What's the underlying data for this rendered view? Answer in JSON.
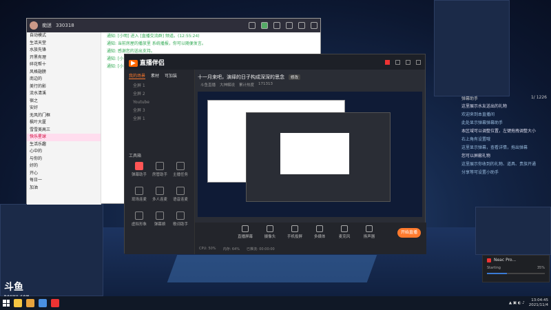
{
  "chat_window": {
    "user": "痴迷",
    "id_label": "330318",
    "left_list": [
      "自动模式",
      "生活天堂",
      "水族先锋",
      "开黑有理",
      "碎花帮十",
      "风格翅膀",
      "南边的",
      "美行的影",
      "流水清溪",
      "宿之",
      "安好",
      "无风的门框",
      "枫叶大厦",
      "雪雪美高三",
      "快乐星球",
      "生活乐趣",
      "心中的",
      "与你的",
      "好的",
      "开心",
      "每日一",
      "加油"
    ],
    "right_lines": [
      "通知: [小明] 进入 [直播交流群] 频道。(12:55:24)",
      "通知: 当前房屋的播放里 系统播报，你可以随便发言。",
      "通知: 感谢您的送出支持。",
      "通知: [小 ] 加入频道",
      "通知: [小] 进入频道"
    ]
  },
  "app": {
    "logo": "直播伴侣",
    "tabs": [
      "我的场景",
      "素材",
      "可加装"
    ],
    "scenes": [
      "全屏 1",
      "全屏 2",
      "Youtube",
      "全屏 3",
      "全屏 1"
    ],
    "tool_title": "工具箱",
    "tools": [
      "弹幕助手",
      "房管助手",
      "主播任务",
      "现场连麦",
      "多人连麦",
      "语音连麦",
      "虚拟形象",
      "弹幕娘",
      "歌词助手"
    ],
    "room_title": "十一月来吧，演绎的日子构成深深的思念",
    "room_tag": "修改",
    "room_sub": [
      "斗鱼直播",
      "大神解说",
      "累计热度",
      "171313"
    ],
    "bottom_items": [
      "直播屏幕",
      "摄像头",
      "手机投屏",
      "多媒体",
      "麦克风",
      "扬声器"
    ],
    "start_label": "开始直播",
    "status": [
      "CPU: 50%",
      "内存: 64%",
      "已推流: 00:00:00"
    ]
  },
  "right_panel": {
    "header_left": "弹幕助手",
    "header_right": "1/ 1226",
    "lines": [
      "这里展示水友送出的礼物",
      "欢迎来到本直播间",
      "此处显示弹幕弹幕助手",
      "本区域可以调整位置，左键拖拽调整大小",
      "右上角有设置哦",
      "这里显示弹幕，查看详情，拖出弹幕",
      "您可以屏蔽礼物",
      "这里展示你收到的礼物、道具、贵族开通",
      "分享等可设置小助手"
    ]
  },
  "progress_popup": {
    "title": "Neac Pro...",
    "status": "Starting",
    "percent": "35%",
    "progress": 0.35
  },
  "watermark": {
    "brand": "斗鱼",
    "sub": "DOUYU.COM"
  },
  "taskbar": {
    "time": "13:04:45",
    "date": "2021/11/4"
  }
}
